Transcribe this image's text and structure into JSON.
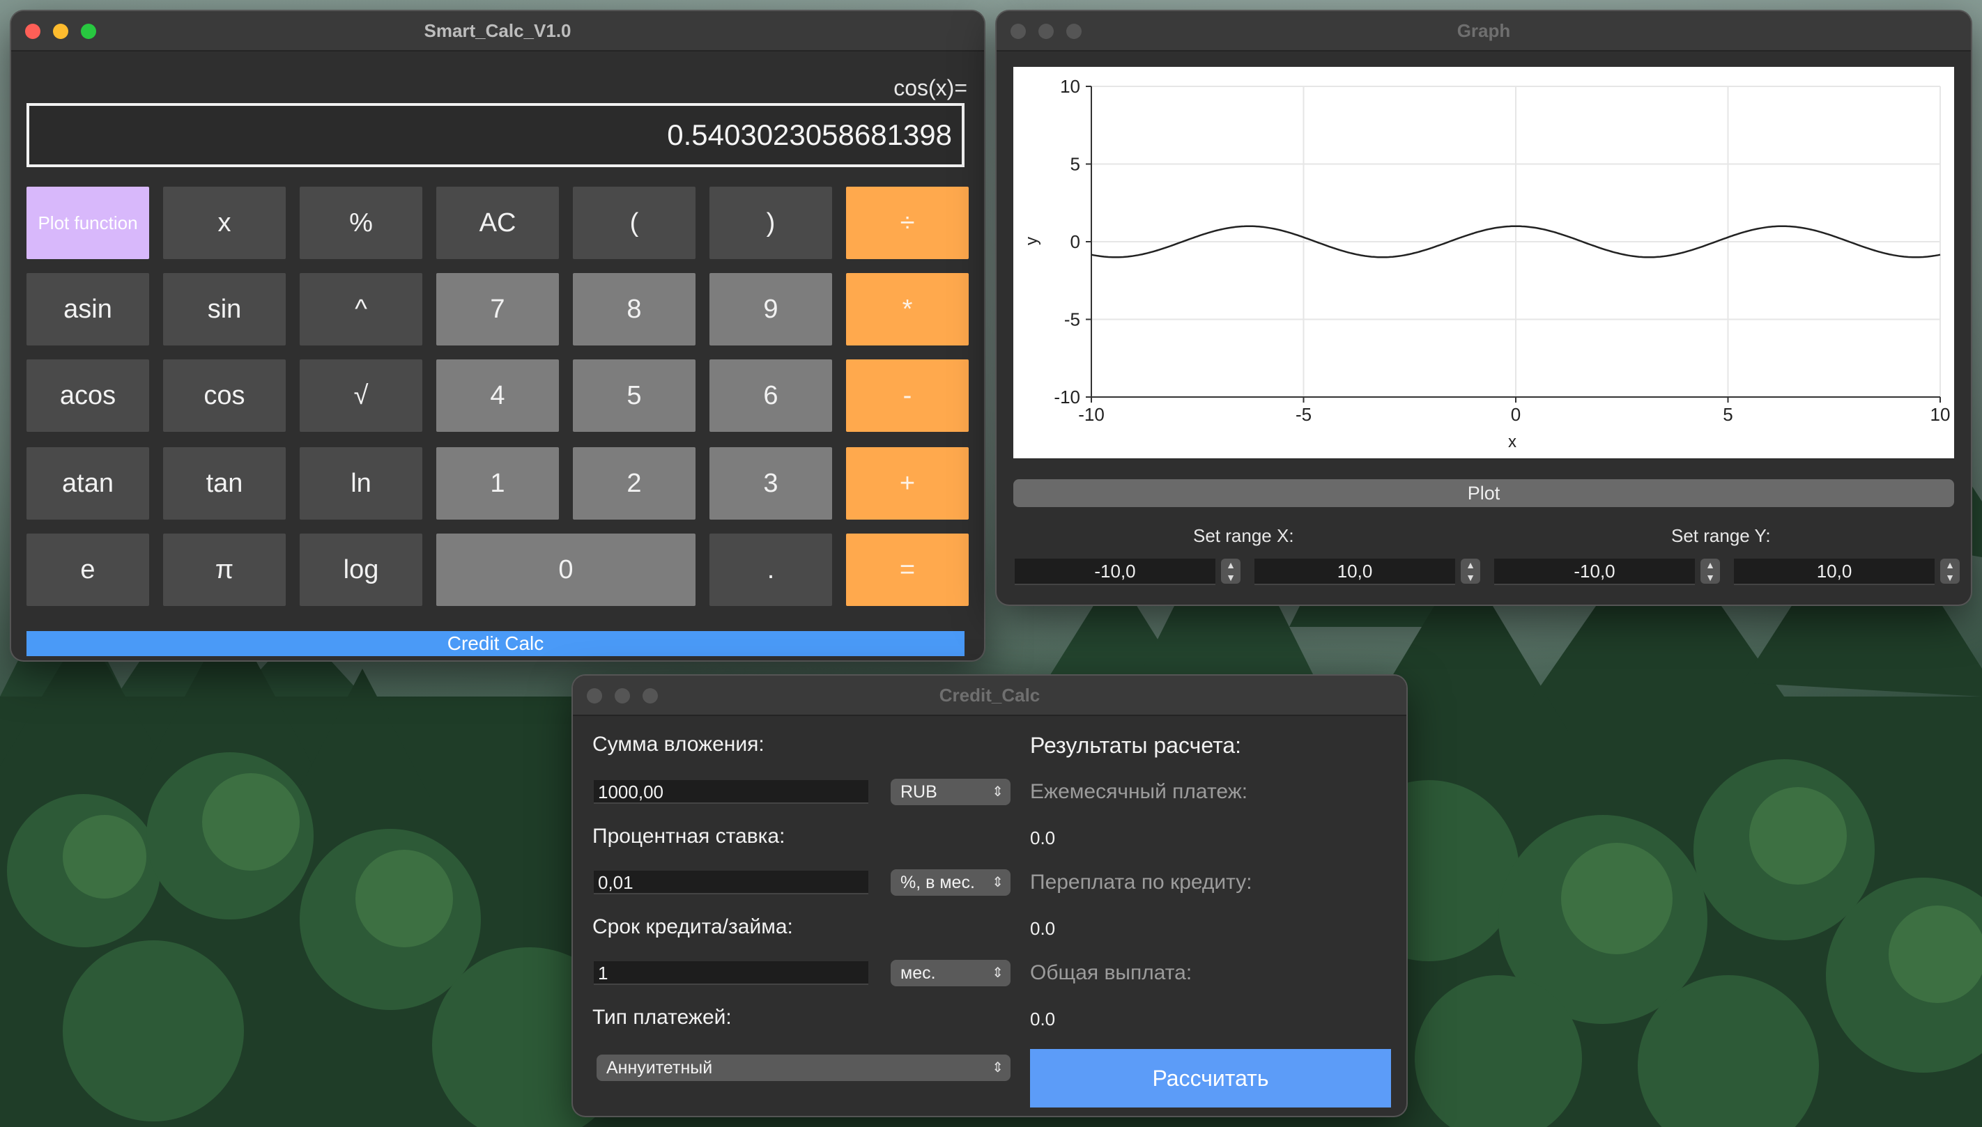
{
  "calculator": {
    "title": "Smart_Calc_V1.0",
    "expression": "cos(x)=",
    "display_value": "0.5403023058681398",
    "keys": {
      "plot": "Plot function",
      "x": "x",
      "percent": "%",
      "ac": "AC",
      "lparen": "(",
      "rparen": ")",
      "div": "÷",
      "asin": "asin",
      "sin": "sin",
      "pow": "^",
      "n7": "7",
      "n8": "8",
      "n9": "9",
      "mul": "*",
      "acos": "acos",
      "cos": "cos",
      "sqrt": "√",
      "n4": "4",
      "n5": "5",
      "n6": "6",
      "minus": "-",
      "atan": "atan",
      "tan": "tan",
      "ln": "ln",
      "n1": "1",
      "n2": "2",
      "n3": "3",
      "plus": "+",
      "e": "e",
      "pi": "π",
      "log": "log",
      "n0": "0",
      "dot": ".",
      "eq": "="
    },
    "credit_button": "Credit Calc"
  },
  "graph": {
    "title": "Graph",
    "plot_button": "Plot",
    "range_x_label": "Set range X:",
    "range_y_label": "Set range Y:",
    "x_min": "-10,0",
    "x_max": "10,0",
    "y_min": "-10,0",
    "y_max": "10,0"
  },
  "chart_data": {
    "type": "line",
    "function": "cos(x)",
    "x_range": [
      -10,
      10
    ],
    "y_range": [
      -10,
      10
    ],
    "xlim": [
      -10,
      10
    ],
    "ylim": [
      -10,
      10
    ],
    "xticks": [
      "-10",
      "-5",
      "0",
      "5",
      "10"
    ],
    "yticks": [
      "10",
      "5",
      "0",
      "-5",
      "-10"
    ],
    "xlabel": "x",
    "ylabel": "y",
    "grid": true,
    "line_color": "#222222"
  },
  "credit": {
    "title": "Credit_Calc",
    "amount_label": "Сумма вложения:",
    "amount_value": "1000,00",
    "currency": "RUB",
    "rate_label": "Процентная ставка:",
    "rate_value": "0,01",
    "rate_unit": "%, в мес.",
    "term_label": "Срок кредита/займа:",
    "term_value": "1",
    "term_unit": "мес.",
    "payment_type_label": "Тип платежей:",
    "payment_type": "Аннуитетный",
    "results_label": "Результаты расчета:",
    "monthly_label": "Ежемесячный платеж:",
    "monthly_value": "0.0",
    "overpay_label": "Переплата по кредиту:",
    "overpay_value": "0.0",
    "total_label": "Общая выплата:",
    "total_value": "0.0",
    "calc_button": "Рассчитать"
  },
  "colors": {
    "accent_orange": "#ffa94d",
    "accent_blue": "#4a9af7",
    "plot_purple": "#d8b8fb",
    "window_bg": "#2f2f2f"
  }
}
